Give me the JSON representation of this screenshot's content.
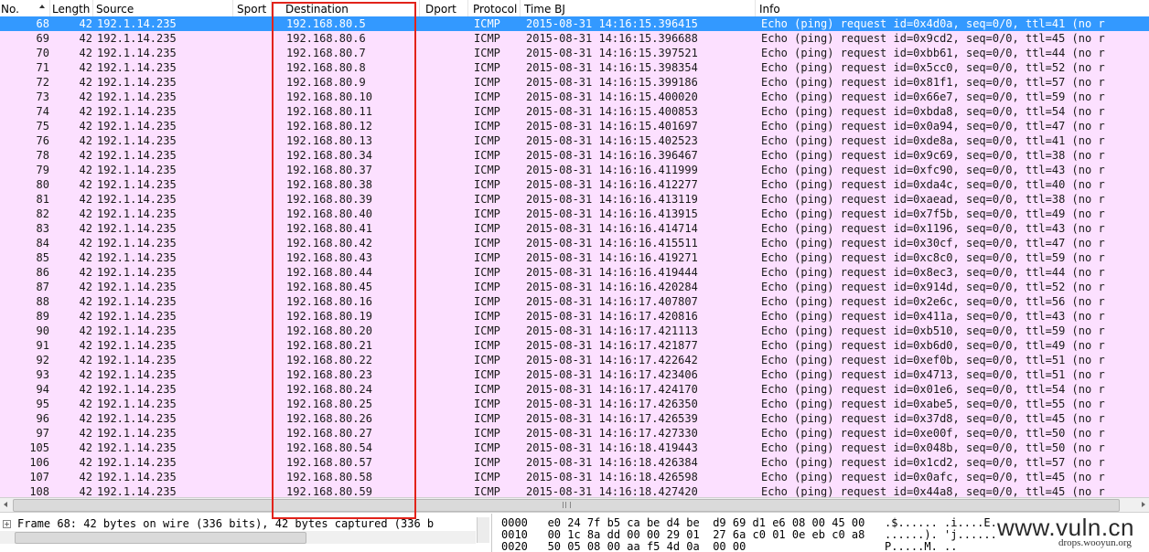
{
  "columns": {
    "no": "No.",
    "length": "Length",
    "source": "Source",
    "sport": "Sport",
    "destination": "Destination",
    "dport": "Dport",
    "protocol": "Protocol",
    "time": "Time BJ",
    "info": "Info"
  },
  "selected_row": 0,
  "packets": [
    {
      "no": "68",
      "len": "42",
      "src": "192.1.14.235",
      "dst": "192.168.80.5",
      "proto": "ICMP",
      "time": "2015-08-31 14:16:15.396415",
      "info": "Echo (ping) request  id=0x4d0a, seq=0/0, ttl=41 (no r"
    },
    {
      "no": "69",
      "len": "42",
      "src": "192.1.14.235",
      "dst": "192.168.80.6",
      "proto": "ICMP",
      "time": "2015-08-31 14:16:15.396688",
      "info": "Echo (ping) request  id=0x9cd2, seq=0/0, ttl=45 (no r"
    },
    {
      "no": "70",
      "len": "42",
      "src": "192.1.14.235",
      "dst": "192.168.80.7",
      "proto": "ICMP",
      "time": "2015-08-31 14:16:15.397521",
      "info": "Echo (ping) request  id=0xbb61, seq=0/0, ttl=44 (no r"
    },
    {
      "no": "71",
      "len": "42",
      "src": "192.1.14.235",
      "dst": "192.168.80.8",
      "proto": "ICMP",
      "time": "2015-08-31 14:16:15.398354",
      "info": "Echo (ping) request  id=0x5cc0, seq=0/0, ttl=52 (no r"
    },
    {
      "no": "72",
      "len": "42",
      "src": "192.1.14.235",
      "dst": "192.168.80.9",
      "proto": "ICMP",
      "time": "2015-08-31 14:16:15.399186",
      "info": "Echo (ping) request  id=0x81f1, seq=0/0, ttl=57 (no r"
    },
    {
      "no": "73",
      "len": "42",
      "src": "192.1.14.235",
      "dst": "192.168.80.10",
      "proto": "ICMP",
      "time": "2015-08-31 14:16:15.400020",
      "info": "Echo (ping) request  id=0x66e7, seq=0/0, ttl=59 (no r"
    },
    {
      "no": "74",
      "len": "42",
      "src": "192.1.14.235",
      "dst": "192.168.80.11",
      "proto": "ICMP",
      "time": "2015-08-31 14:16:15.400853",
      "info": "Echo (ping) request  id=0xbda8, seq=0/0, ttl=54 (no r"
    },
    {
      "no": "75",
      "len": "42",
      "src": "192.1.14.235",
      "dst": "192.168.80.12",
      "proto": "ICMP",
      "time": "2015-08-31 14:16:15.401697",
      "info": "Echo (ping) request  id=0x0a94, seq=0/0, ttl=47 (no r"
    },
    {
      "no": "76",
      "len": "42",
      "src": "192.1.14.235",
      "dst": "192.168.80.13",
      "proto": "ICMP",
      "time": "2015-08-31 14:16:15.402523",
      "info": "Echo (ping) request  id=0xde8a, seq=0/0, ttl=41 (no r"
    },
    {
      "no": "78",
      "len": "42",
      "src": "192.1.14.235",
      "dst": "192.168.80.34",
      "proto": "ICMP",
      "time": "2015-08-31 14:16:16.396467",
      "info": "Echo (ping) request  id=0x9c69, seq=0/0, ttl=38 (no r"
    },
    {
      "no": "79",
      "len": "42",
      "src": "192.1.14.235",
      "dst": "192.168.80.37",
      "proto": "ICMP",
      "time": "2015-08-31 14:16:16.411999",
      "info": "Echo (ping) request  id=0xfc90, seq=0/0, ttl=43 (no r"
    },
    {
      "no": "80",
      "len": "42",
      "src": "192.1.14.235",
      "dst": "192.168.80.38",
      "proto": "ICMP",
      "time": "2015-08-31 14:16:16.412277",
      "info": "Echo (ping) request  id=0xda4c, seq=0/0, ttl=40 (no r"
    },
    {
      "no": "81",
      "len": "42",
      "src": "192.1.14.235",
      "dst": "192.168.80.39",
      "proto": "ICMP",
      "time": "2015-08-31 14:16:16.413119",
      "info": "Echo (ping) request  id=0xaead, seq=0/0, ttl=38 (no r"
    },
    {
      "no": "82",
      "len": "42",
      "src": "192.1.14.235",
      "dst": "192.168.80.40",
      "proto": "ICMP",
      "time": "2015-08-31 14:16:16.413915",
      "info": "Echo (ping) request  id=0x7f5b, seq=0/0, ttl=49 (no r"
    },
    {
      "no": "83",
      "len": "42",
      "src": "192.1.14.235",
      "dst": "192.168.80.41",
      "proto": "ICMP",
      "time": "2015-08-31 14:16:16.414714",
      "info": "Echo (ping) request  id=0x1196, seq=0/0, ttl=43 (no r"
    },
    {
      "no": "84",
      "len": "42",
      "src": "192.1.14.235",
      "dst": "192.168.80.42",
      "proto": "ICMP",
      "time": "2015-08-31 14:16:16.415511",
      "info": "Echo (ping) request  id=0x30cf, seq=0/0, ttl=47 (no r"
    },
    {
      "no": "85",
      "len": "42",
      "src": "192.1.14.235",
      "dst": "192.168.80.43",
      "proto": "ICMP",
      "time": "2015-08-31 14:16:16.419271",
      "info": "Echo (ping) request  id=0xc8c0, seq=0/0, ttl=59 (no r"
    },
    {
      "no": "86",
      "len": "42",
      "src": "192.1.14.235",
      "dst": "192.168.80.44",
      "proto": "ICMP",
      "time": "2015-08-31 14:16:16.419444",
      "info": "Echo (ping) request  id=0x8ec3, seq=0/0, ttl=44 (no r"
    },
    {
      "no": "87",
      "len": "42",
      "src": "192.1.14.235",
      "dst": "192.168.80.45",
      "proto": "ICMP",
      "time": "2015-08-31 14:16:16.420284",
      "info": "Echo (ping) request  id=0x914d, seq=0/0, ttl=52 (no r"
    },
    {
      "no": "88",
      "len": "42",
      "src": "192.1.14.235",
      "dst": "192.168.80.16",
      "proto": "ICMP",
      "time": "2015-08-31 14:16:17.407807",
      "info": "Echo (ping) request  id=0x2e6c, seq=0/0, ttl=56 (no r"
    },
    {
      "no": "89",
      "len": "42",
      "src": "192.1.14.235",
      "dst": "192.168.80.19",
      "proto": "ICMP",
      "time": "2015-08-31 14:16:17.420816",
      "info": "Echo (ping) request  id=0x411a, seq=0/0, ttl=43 (no r"
    },
    {
      "no": "90",
      "len": "42",
      "src": "192.1.14.235",
      "dst": "192.168.80.20",
      "proto": "ICMP",
      "time": "2015-08-31 14:16:17.421113",
      "info": "Echo (ping) request  id=0xb510, seq=0/0, ttl=59 (no r"
    },
    {
      "no": "91",
      "len": "42",
      "src": "192.1.14.235",
      "dst": "192.168.80.21",
      "proto": "ICMP",
      "time": "2015-08-31 14:16:17.421877",
      "info": "Echo (ping) request  id=0xb6d0, seq=0/0, ttl=49 (no r"
    },
    {
      "no": "92",
      "len": "42",
      "src": "192.1.14.235",
      "dst": "192.168.80.22",
      "proto": "ICMP",
      "time": "2015-08-31 14:16:17.422642",
      "info": "Echo (ping) request  id=0xef0b, seq=0/0, ttl=51 (no r"
    },
    {
      "no": "93",
      "len": "42",
      "src": "192.1.14.235",
      "dst": "192.168.80.23",
      "proto": "ICMP",
      "time": "2015-08-31 14:16:17.423406",
      "info": "Echo (ping) request  id=0x4713, seq=0/0, ttl=51 (no r"
    },
    {
      "no": "94",
      "len": "42",
      "src": "192.1.14.235",
      "dst": "192.168.80.24",
      "proto": "ICMP",
      "time": "2015-08-31 14:16:17.424170",
      "info": "Echo (ping) request  id=0x01e6, seq=0/0, ttl=54 (no r"
    },
    {
      "no": "95",
      "len": "42",
      "src": "192.1.14.235",
      "dst": "192.168.80.25",
      "proto": "ICMP",
      "time": "2015-08-31 14:16:17.426350",
      "info": "Echo (ping) request  id=0xabe5, seq=0/0, ttl=55 (no r"
    },
    {
      "no": "96",
      "len": "42",
      "src": "192.1.14.235",
      "dst": "192.168.80.26",
      "proto": "ICMP",
      "time": "2015-08-31 14:16:17.426539",
      "info": "Echo (ping) request  id=0x37d8, seq=0/0, ttl=45 (no r"
    },
    {
      "no": "97",
      "len": "42",
      "src": "192.1.14.235",
      "dst": "192.168.80.27",
      "proto": "ICMP",
      "time": "2015-08-31 14:16:17.427330",
      "info": "Echo (ping) request  id=0xe00f, seq=0/0, ttl=50 (no r"
    },
    {
      "no": "105",
      "len": "42",
      "src": "192.1.14.235",
      "dst": "192.168.80.54",
      "proto": "ICMP",
      "time": "2015-08-31 14:16:18.419443",
      "info": "Echo (ping) request  id=0x048b, seq=0/0, ttl=50 (no r"
    },
    {
      "no": "106",
      "len": "42",
      "src": "192.1.14.235",
      "dst": "192.168.80.57",
      "proto": "ICMP",
      "time": "2015-08-31 14:16:18.426384",
      "info": "Echo (ping) request  id=0x1cd2, seq=0/0, ttl=57 (no r"
    },
    {
      "no": "107",
      "len": "42",
      "src": "192.1.14.235",
      "dst": "192.168.80.58",
      "proto": "ICMP",
      "time": "2015-08-31 14:16:18.426598",
      "info": "Echo (ping) request  id=0x0afc, seq=0/0, ttl=45 (no r"
    },
    {
      "no": "108",
      "len": "42",
      "src": "192.1.14.235",
      "dst": "192.168.80.59",
      "proto": "ICMP",
      "time": "2015-08-31 14:16:18.427420",
      "info": "Echo (ping) request  id=0x44a8, seq=0/0, ttl=45 (no r"
    }
  ],
  "details": {
    "expander": "+",
    "frame_line": "Frame 68: 42 bytes on wire (336 bits), 42 bytes captured (336 b"
  },
  "hex": {
    "lines": [
      "0000   e0 24 7f b5 ca be d4 be  d9 69 d1 e6 08 00 45 00   .$...... .i....E.",
      "0010   00 1c 8a dd 00 00 29 01  27 6a c0 01 0e eb c0 a8   ......). 'j......",
      "0020   50 05 08 00 aa f5 4d 0a  00 00                     P.....M. .."
    ]
  },
  "watermark": {
    "main": "www.vuln.cn",
    "sub": "drops.wooyun.org"
  },
  "colors": {
    "row_bg": "#fce0ff",
    "selected_bg": "#3399ff",
    "highlight_box": "#e2231a"
  }
}
